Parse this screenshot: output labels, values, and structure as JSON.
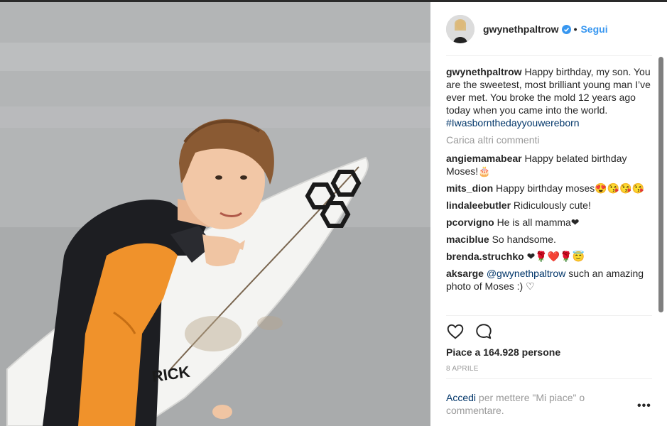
{
  "post": {
    "username": "gwynethpaltrow",
    "separator": "•",
    "follow_label": "Segui",
    "caption_user": "gwynethpaltrow",
    "caption_text": "Happy birthday, my son. You are the sweetest, most brilliant young man I’ve ever met. You broke the mold 12 years ago today when you came into the world.",
    "caption_hashtag": "#Iwasbornthedayyouwereborn",
    "load_more": "Carica altri commenti",
    "comments": [
      {
        "user": "angiemamabear",
        "text": "Happy belated birthday Moses!🎂"
      },
      {
        "user": "mits_dion",
        "text": "Happy birthday moses😍😘😘😘"
      },
      {
        "user": "lindaleebutler",
        "text": "Ridiculously cute!"
      },
      {
        "user": "pcorvigno",
        "text": "He is all mamma❤"
      },
      {
        "user": "maciblue",
        "text": "So handsome."
      },
      {
        "user": "brenda.struchko",
        "text": "❤🌹❤️🌹😇"
      },
      {
        "user": "aksarge",
        "mention": "@gwynethpaltrow",
        "text": " such an amazing photo of Moses :) ♡"
      }
    ],
    "likes": "Piace a 164.928 persone",
    "date": "8 APRILE",
    "login_link": "Accedi",
    "login_text": " per mettere \"Mi piace\" o commentare.",
    "more_icon": "•••"
  },
  "icons": {
    "verified": "verified-badge-icon",
    "like": "heart-icon",
    "comment": "comment-bubble-icon",
    "more": "more-options-icon"
  },
  "colors": {
    "link": "#3897f0",
    "hashtag": "#003569",
    "muted": "#999999",
    "wetsuit_orange": "#f0922b"
  }
}
